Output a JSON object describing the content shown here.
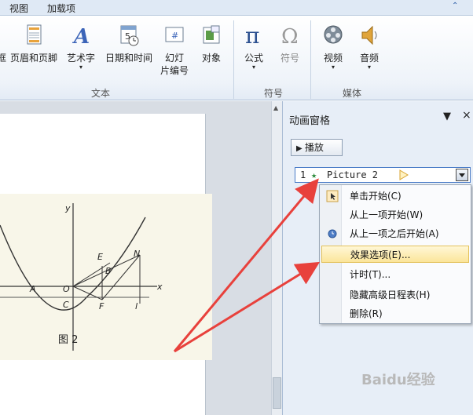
{
  "tabs": [
    "视图",
    "加载项"
  ],
  "ribbon": {
    "groups": [
      {
        "label": "文本",
        "buttons": [
          {
            "label": "框",
            "dropdown": false
          },
          {
            "label": "页眉和页脚",
            "dropdown": false
          },
          {
            "label": "艺术字",
            "dropdown": true
          },
          {
            "label": "日期和时间",
            "dropdown": false
          },
          {
            "label": "幻灯\n片编号",
            "dropdown": false
          },
          {
            "label": "对象",
            "dropdown": false
          }
        ]
      },
      {
        "label": "符号",
        "buttons": [
          {
            "label": "公式",
            "dropdown": true
          },
          {
            "label": "符号",
            "dropdown": false
          }
        ]
      },
      {
        "label": "媒体",
        "buttons": [
          {
            "label": "视频",
            "dropdown": true
          },
          {
            "label": "音频",
            "dropdown": true
          }
        ]
      }
    ]
  },
  "pane": {
    "title": "动画窗格",
    "play_label": "播放",
    "item": {
      "index": "1",
      "name": "Picture 2"
    }
  },
  "context_menu": [
    {
      "label": "单击开始(C)",
      "icon": "mouse-click-icon",
      "highlighted": false
    },
    {
      "label": "从上一项开始(W)",
      "icon": "",
      "highlighted": false
    },
    {
      "label": "从上一项之后开始(A)",
      "icon": "clock-icon",
      "highlighted": false
    },
    {
      "label": "效果选项(E)...",
      "icon": "",
      "highlighted": true
    },
    {
      "label": "计时(T)...",
      "icon": "",
      "highlighted": false
    },
    {
      "label": "隐藏高级日程表(H)",
      "icon": "",
      "highlighted": false
    },
    {
      "label": "删除(R)",
      "icon": "",
      "highlighted": false
    }
  ],
  "figure": {
    "caption": "图 2",
    "labels": [
      "y",
      "x",
      "O",
      "A",
      "B",
      "C",
      "E",
      "F",
      "N",
      "l"
    ]
  },
  "watermark": "Baidu经验",
  "colors": {
    "arrow": "#e8413c",
    "menu_highlight": "#fbe59a",
    "pane_bg": "#e7eef7"
  }
}
